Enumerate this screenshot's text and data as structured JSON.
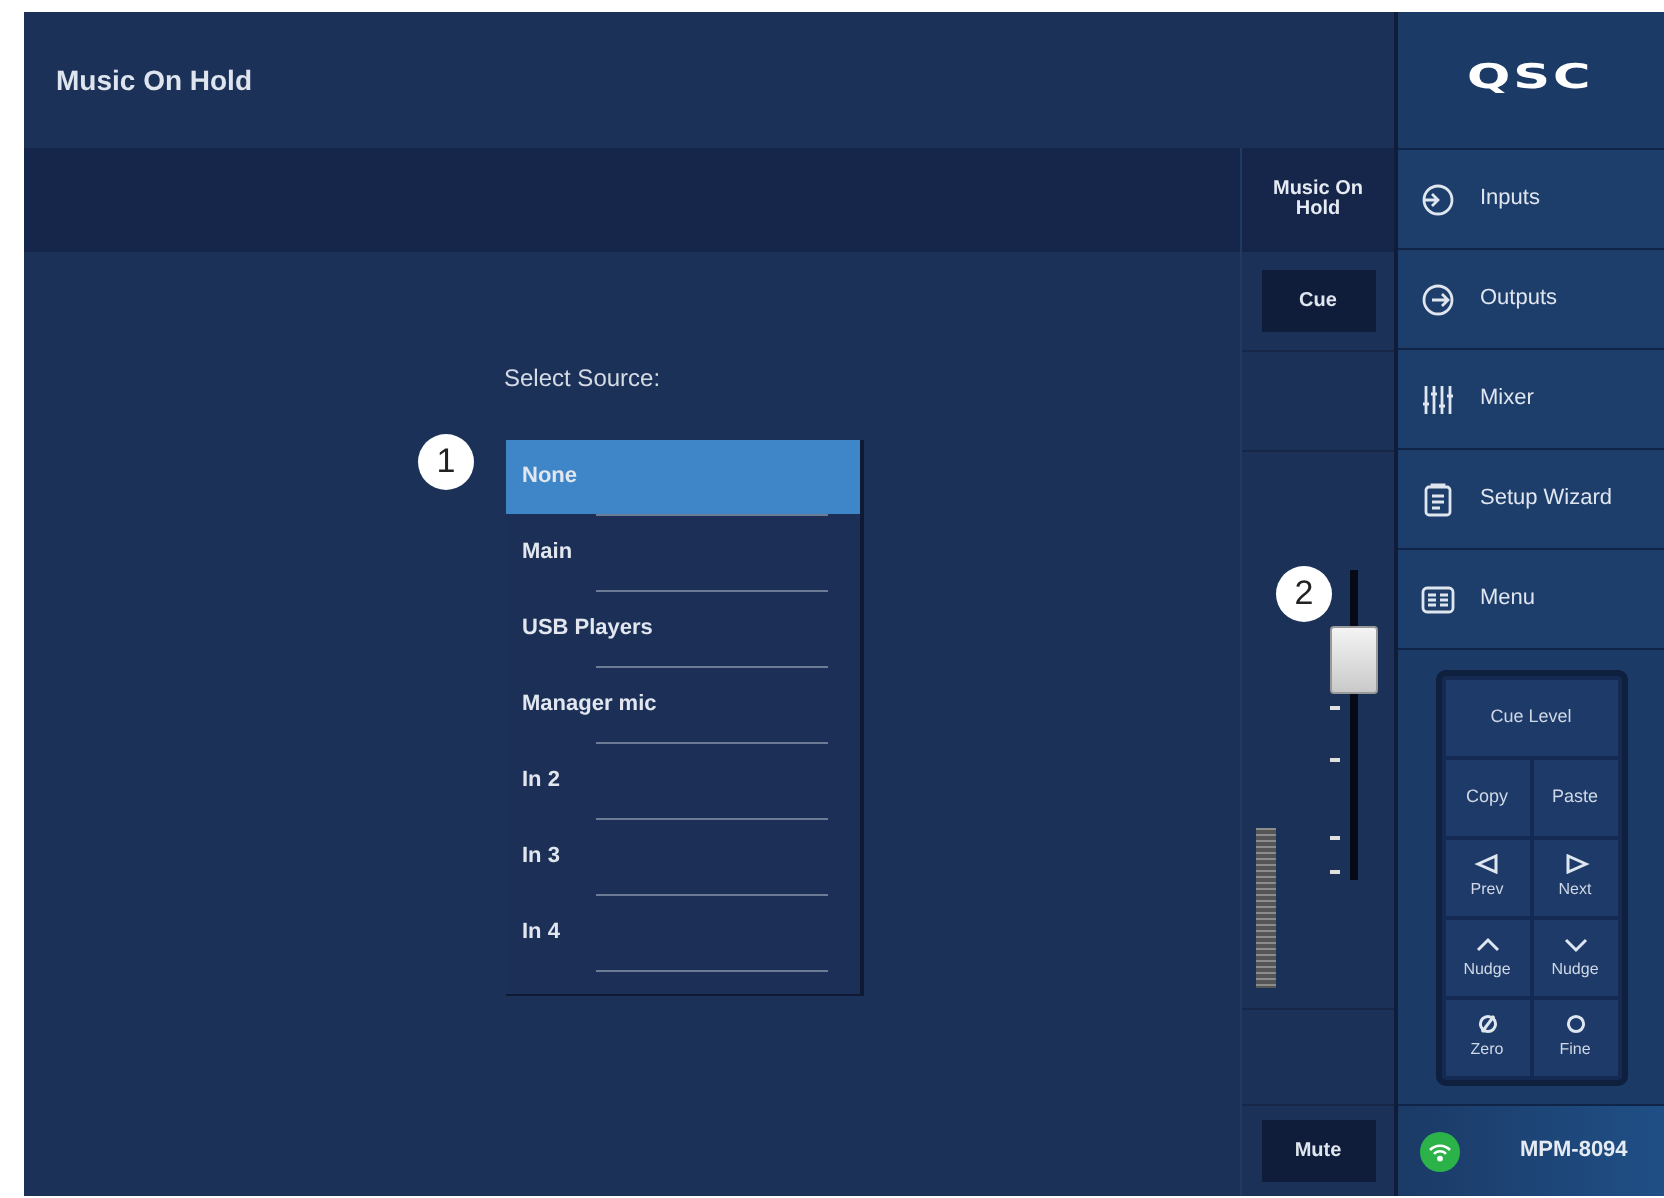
{
  "header": {
    "title": "Music On Hold"
  },
  "logo": {
    "text": "QSC"
  },
  "source_select": {
    "label": "Select Source:",
    "callout": "1",
    "options": [
      {
        "label": "None",
        "selected": true
      },
      {
        "label": "Main",
        "selected": false
      },
      {
        "label": "USB Players",
        "selected": false
      },
      {
        "label": "Manager mic",
        "selected": false
      },
      {
        "label": "In 2",
        "selected": false
      },
      {
        "label": "In 3",
        "selected": false
      },
      {
        "label": "In 4",
        "selected": false
      }
    ]
  },
  "channel_strip": {
    "name": "Music On Hold",
    "cue_button": "Cue",
    "fader": {
      "callout": "2",
      "level": 0.71
    },
    "mute_button": "Mute"
  },
  "nav": [
    {
      "label": "Inputs",
      "kind": "inputs"
    },
    {
      "label": "Outputs",
      "kind": "outputs"
    },
    {
      "label": "Mixer",
      "kind": "mixer"
    },
    {
      "label": "Setup Wizard",
      "kind": "wizard"
    },
    {
      "label": "Menu",
      "kind": "menu"
    }
  ],
  "keypad": [
    {
      "label": "Cue Level",
      "kind": "wide"
    },
    {
      "label": "Copy",
      "kind": "text"
    },
    {
      "label": "Paste",
      "kind": "text"
    },
    {
      "label": "Prev",
      "kind": "prev"
    },
    {
      "label": "Next",
      "kind": "next"
    },
    {
      "label": "Nudge",
      "kind": "up"
    },
    {
      "label": "Nudge",
      "kind": "down"
    },
    {
      "label": "Zero",
      "kind": "zero"
    },
    {
      "label": "Fine",
      "kind": "fine"
    }
  ],
  "status": {
    "device": "MPM-8094",
    "connected": true
  }
}
